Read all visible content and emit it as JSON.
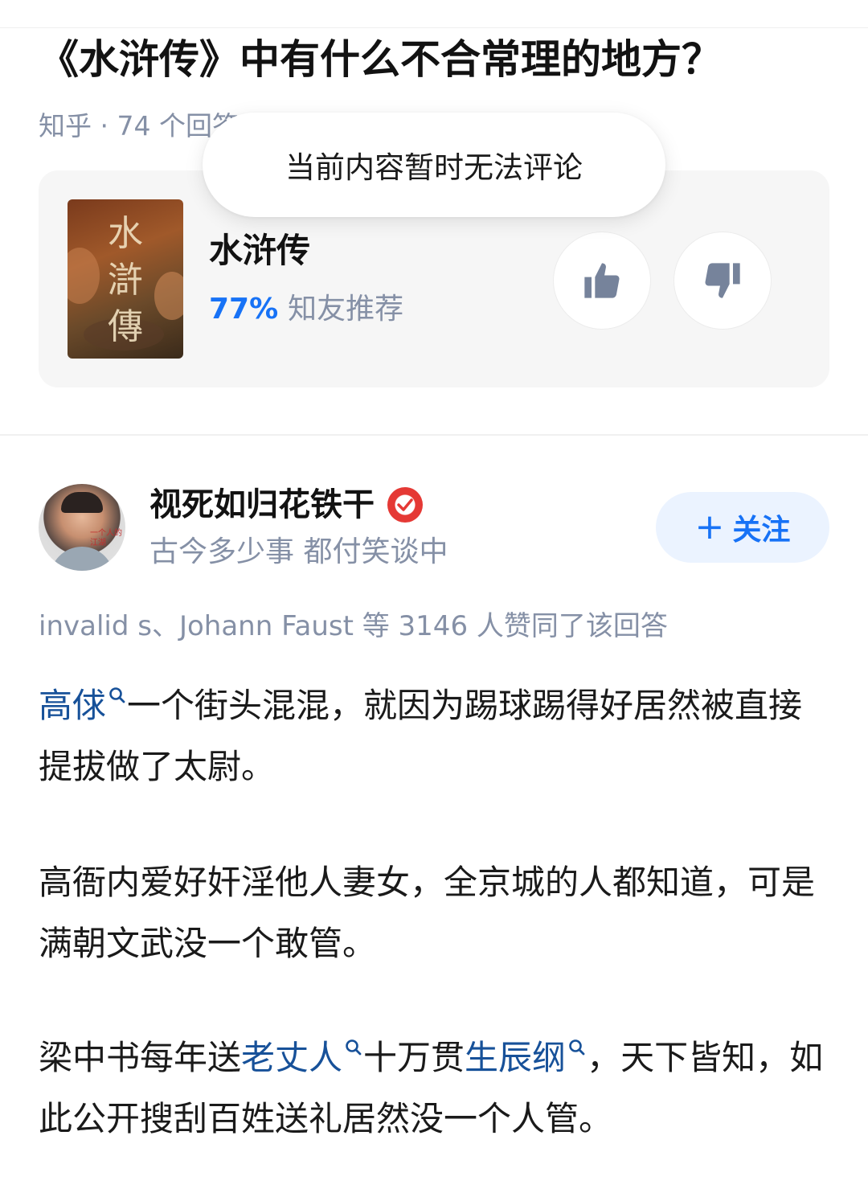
{
  "question": {
    "title": "《水浒传》中有什么不合常理的地方？",
    "meta": "知乎 · 74 个回答"
  },
  "toast": {
    "text": "当前内容暂时无法评论"
  },
  "book_card": {
    "cover_chars": "水滸傳",
    "name": "水浒传",
    "percent": "77%",
    "recommend_label": "知友推荐",
    "upvote_icon": "thumbs-up-icon",
    "downvote_icon": "thumbs-down-icon"
  },
  "author": {
    "name": "视死如归花铁干",
    "badge_icon": "verified-badge-icon",
    "bio": "古今多少事 都付笑谈中",
    "follow_label": "关注",
    "follow_plus": "+",
    "avatar_caption": "一个人的江湖"
  },
  "likes_line": "invalid s、Johann Faust 等 3146 人赞同了该回答",
  "answer": {
    "p1": {
      "link1": "高俅",
      "text1": "一个街头混混，就因为踢球踢得好居然被直接提拔做了太尉。"
    },
    "p2": {
      "text": "高衙内爱好奸淫他人妻女，全京城的人都知道，可是满朝文武没一个敢管。"
    },
    "p3": {
      "text1": "梁中书每年送",
      "link1": "老丈人",
      "text2": "十万贯",
      "link2": "生辰纲",
      "text3": "，天下皆知，如此公开搜刮百姓送礼居然没一个人管。"
    }
  },
  "colors": {
    "link": "#175199",
    "accent_blue": "#1772f6",
    "muted": "#8590a6",
    "badge_red": "#e53935"
  }
}
